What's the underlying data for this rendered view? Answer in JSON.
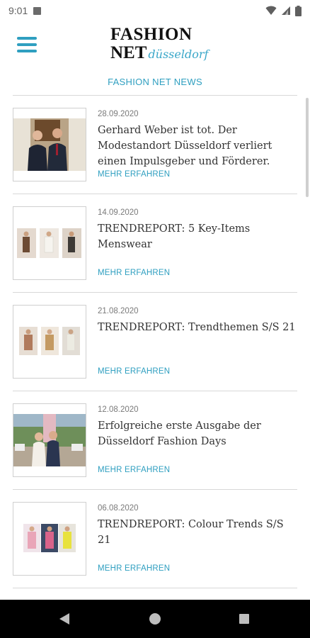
{
  "status_bar": {
    "time": "9:01",
    "icons": [
      "sim-card-icon",
      "wifi-icon",
      "cellular-signal-icon",
      "battery-icon"
    ]
  },
  "header": {
    "menu_icon": "hamburger-menu-icon",
    "logo": {
      "line1": "FASHION",
      "line2": "NET",
      "city": "düsseldorf"
    }
  },
  "section": {
    "title": "FASHION NET NEWS"
  },
  "news": [
    {
      "date": "28.09.2020",
      "title": "Gerhard Weber ist tot. Der Modestandort Düsseldorf verliert einen Impulsgeber und Förderer.",
      "more": "MEHR ERFAHREN"
    },
    {
      "date": "14.09.2020",
      "title": "TRENDREPORT: 5 Key-Items Menswear",
      "more": "MEHR ERFAHREN"
    },
    {
      "date": "21.08.2020",
      "title": "TRENDREPORT: Trendthemen S/S 21",
      "more": "MEHR ERFAHREN"
    },
    {
      "date": "12.08.2020",
      "title": "Erfolgreiche erste Ausgabe der Düsseldorf Fashion Days",
      "more": "MEHR ERFAHREN"
    },
    {
      "date": "06.08.2020",
      "title": "TRENDREPORT: Colour Trends S/S 21",
      "more": "MEHR ERFAHREN"
    }
  ],
  "nav_bar": {
    "icons": [
      "back-icon",
      "home-icon",
      "recents-icon"
    ]
  },
  "colors": {
    "accent": "#2f9fc0",
    "divider": "#d8d8d8",
    "nav_background": "#000000"
  }
}
